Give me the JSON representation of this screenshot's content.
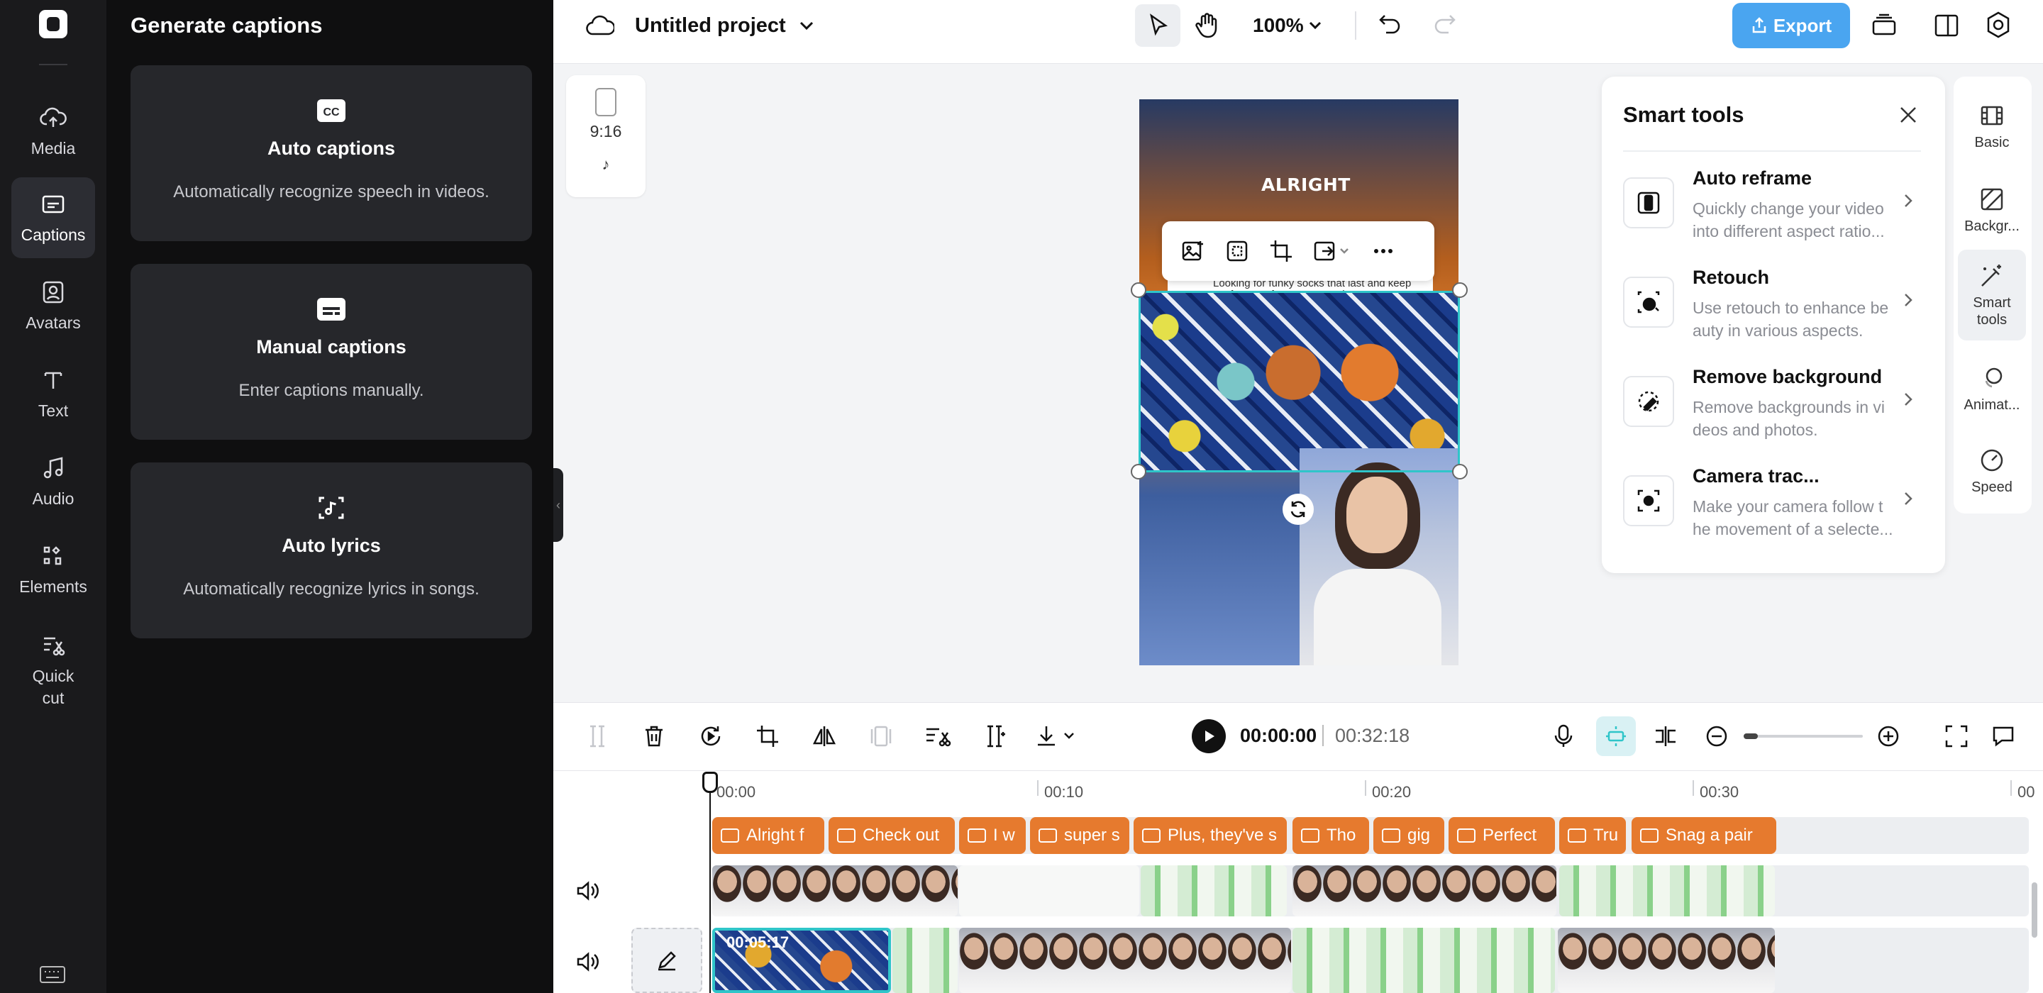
{
  "rail": {
    "items": [
      {
        "label": "Media",
        "icon": "cloud-upload-icon"
      },
      {
        "label": "Captions",
        "icon": "captions-icon",
        "active": true
      },
      {
        "label": "Avatars",
        "icon": "avatar-icon"
      },
      {
        "label": "Text",
        "icon": "text-icon"
      },
      {
        "label": "Audio",
        "icon": "music-note-icon"
      },
      {
        "label": "Elements",
        "icon": "elements-icon"
      },
      {
        "label": "Quick cut",
        "icon": "quick-cut-icon"
      }
    ]
  },
  "panel": {
    "title": "Generate captions",
    "cards": [
      {
        "title": "Auto captions",
        "desc": "Automatically recognize speech in videos.",
        "icon": "cc-icon"
      },
      {
        "title": "Manual captions",
        "desc": "Enter captions manually.",
        "icon": "subtitle-icon"
      },
      {
        "title": "Auto lyrics",
        "desc": "Automatically recognize lyrics in songs.",
        "icon": "lyrics-scan-icon"
      }
    ]
  },
  "topbar": {
    "project_title": "Untitled project",
    "zoom": "100%",
    "export_label": "Export"
  },
  "canvas": {
    "ratio_label": "9:16",
    "video_title_text": "ALRIGHT",
    "comment_text": "Looking for funky socks that last and keep my feet comfy. Any suggestions?"
  },
  "smart_tools": {
    "title": "Smart tools",
    "tools": [
      {
        "name": "Auto reframe",
        "desc": "Quickly change your video into different aspect ratio...",
        "icon": "reframe-icon"
      },
      {
        "name": "Retouch",
        "desc": "Use retouch to enhance be auty in various aspects.",
        "icon": "retouch-icon"
      },
      {
        "name": "Remove background",
        "desc": "Remove backgrounds in vi deos and photos.",
        "icon": "magic-eraser-icon"
      },
      {
        "name": "Camera trac...",
        "desc": "Make your camera follow t he movement of a selecte...",
        "icon": "camera-track-icon"
      }
    ]
  },
  "right_rail": {
    "items": [
      {
        "label": "Basic",
        "icon": "film-icon"
      },
      {
        "label": "Backgr...",
        "icon": "background-icon"
      },
      {
        "label": "Smart tools",
        "icon": "magic-wand-icon",
        "active": true
      },
      {
        "label": "Animat...",
        "icon": "animation-icon"
      },
      {
        "label": "Speed",
        "icon": "speed-icon"
      }
    ]
  },
  "playback": {
    "current": "00:00:00",
    "separator": "|",
    "duration": "00:32:18"
  },
  "timeline": {
    "ruler": [
      "00:00",
      "00:10",
      "00:20",
      "00:30",
      "00"
    ],
    "captions": [
      "Alright f",
      "Check out",
      "I w",
      "super s",
      "Plus, they've s",
      "Tho",
      "gig",
      "Perfect",
      "Tru",
      "Snag a pair"
    ],
    "selected_clip_time": "00:05:17"
  },
  "colors": {
    "accent_blue": "#4aa5f0",
    "caption_orange": "#e67a2e",
    "selection_teal": "#2fc5c9",
    "dark_rail": "#1a1a1c"
  }
}
